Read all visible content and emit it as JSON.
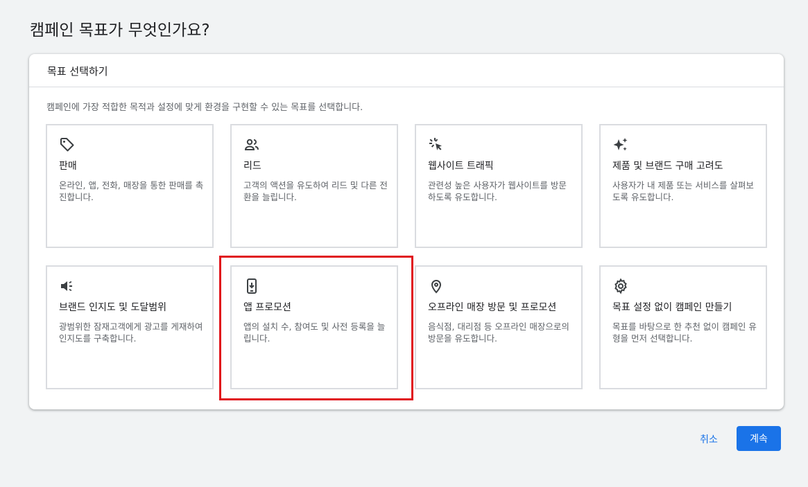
{
  "page": {
    "title": "캠페인 목표가 무엇인가요?"
  },
  "card": {
    "header": "목표 선택하기",
    "description": "캠페인에 가장 적합한 목적과 설정에 맞게 환경을 구현할 수 있는 목표를 선택합니다."
  },
  "goals": [
    {
      "icon": "tag-icon",
      "title": "판매",
      "desc": "온라인, 앱, 전화, 매장을 통한 판매를 촉진합니다."
    },
    {
      "icon": "people-icon",
      "title": "리드",
      "desc": "고객의 액션을 유도하여 리드 및 다른 전환을 늘립니다."
    },
    {
      "icon": "cursor-click-icon",
      "title": "웹사이트 트래픽",
      "desc": "관련성 높은 사용자가 웹사이트를 방문하도록 유도합니다."
    },
    {
      "icon": "sparkle-icon",
      "title": "제품 및 브랜드 구매 고려도",
      "desc": "사용자가 내 제품 또는 서비스를 살펴보도록 유도합니다."
    },
    {
      "icon": "megaphone-icon",
      "title": "브랜드 인지도 및 도달범위",
      "desc": "광범위한 잠재고객에게 광고를 게재하여 인지도를 구축합니다."
    },
    {
      "icon": "phone-download-icon",
      "title": "앱 프로모션",
      "desc": "앱의 설치 수, 참여도 및 사전 등록을 늘립니다."
    },
    {
      "icon": "location-pin-icon",
      "title": "오프라인 매장 방문 및 프로모션",
      "desc": "음식점, 대리점 등 오프라인 매장으로의 방문을 유도합니다."
    },
    {
      "icon": "gear-icon",
      "title": "목표 설정 없이 캠페인 만들기",
      "desc": "목표를 바탕으로 한 추천 없이 캠페인 유형을 먼저 선택합니다."
    }
  ],
  "actions": {
    "cancel": "취소",
    "continue": "계속"
  },
  "colors": {
    "accent": "#1a73e8",
    "highlight": "#e0131b"
  }
}
